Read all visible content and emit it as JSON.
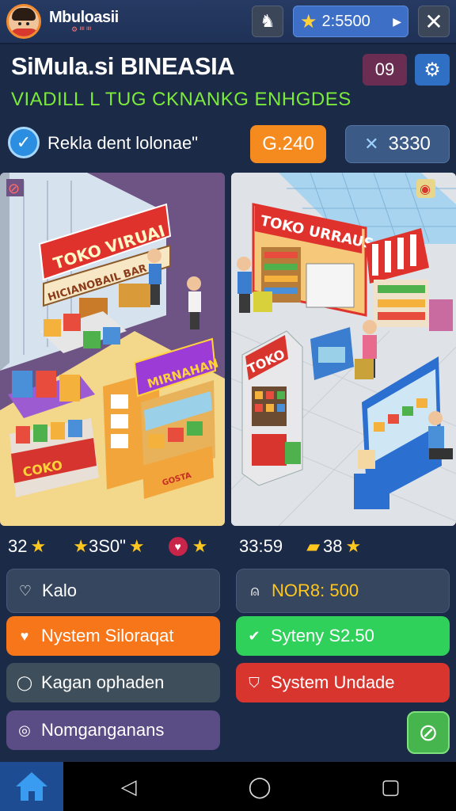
{
  "header": {
    "player_name": "Mbuloasii",
    "player_sub": "⚙ ᴵᴵᴵᴵ ᴵᴵᴵᴵ",
    "coins": "2:5500"
  },
  "title": "SiMula.si BINEASIA",
  "subtitle": "VIADILL L TUG CKNANKG ENHGDES",
  "level": "09",
  "info": {
    "text": "Rekla dent lolonae\"",
    "gold": "G.240",
    "gems": "3330"
  },
  "stores": {
    "left": {
      "sign_main": "TOKO VIRUAI",
      "sign_sub": "HICIANOBAIL BAR",
      "stand_sign": "MIRNAHAN",
      "cart_sign": "COKO",
      "stand_small": "GOSTA"
    },
    "right": {
      "sign_main": "TOKO URRAUS",
      "machine_sign": "TOKO"
    }
  },
  "stats": {
    "left_1": "32",
    "left_2": "3S0\"",
    "right_1": "33:59",
    "right_2": "38"
  },
  "actions": {
    "left": [
      {
        "label": "Kalo",
        "style": "plain"
      },
      {
        "label": "Nystem Siloraqat",
        "style": "orange"
      },
      {
        "label": "Kagan ophaden",
        "style": "gray"
      },
      {
        "label": "Nomganganans",
        "style": "purple"
      }
    ],
    "right": [
      {
        "label": "NOR8: 500",
        "style": "plain"
      },
      {
        "label": "Syteny S2.50",
        "style": "green"
      },
      {
        "label": "System Undade",
        "style": "red"
      }
    ]
  },
  "colors": {
    "accent_orange": "#f8761a",
    "accent_green": "#2fd15a",
    "accent_red": "#d9352f",
    "background": "#1b2a47"
  }
}
